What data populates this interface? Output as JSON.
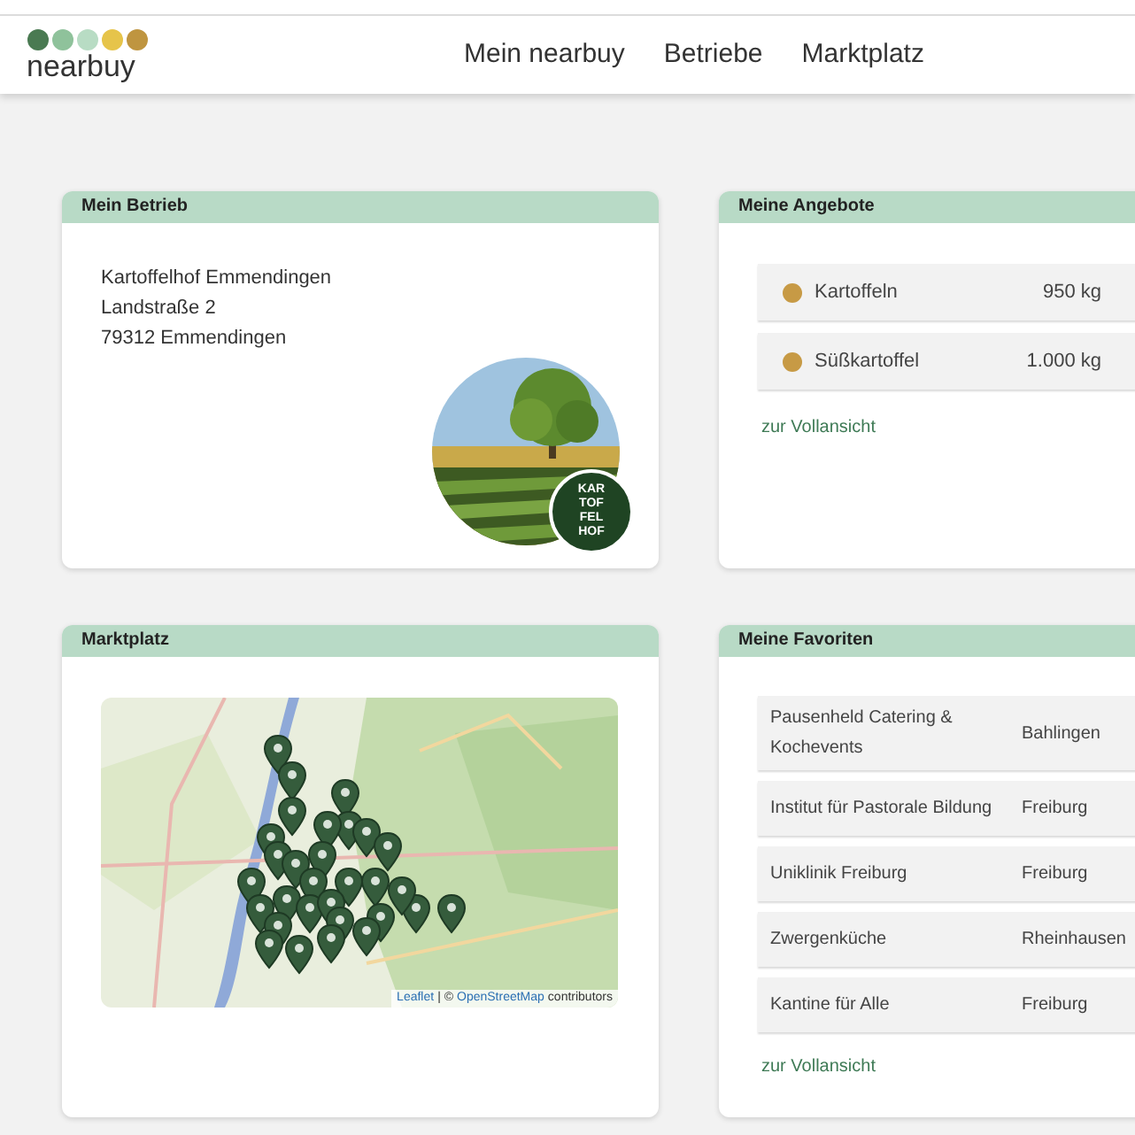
{
  "header": {
    "logo": {
      "text": "nearbuy"
    },
    "nav": [
      {
        "label": "Mein nearbuy"
      },
      {
        "label": "Betriebe"
      },
      {
        "label": "Marktplatz"
      }
    ]
  },
  "my_business": {
    "title": "Mein Betrieb",
    "address": [
      "Kartoffelhof Emmendingen",
      "Landstraße 2",
      "79312 Emmendingen"
    ],
    "logo_lines": [
      "KAR",
      "TOF",
      "FEL",
      "HOF"
    ]
  },
  "my_offers": {
    "title": "Meine Angebote",
    "items": [
      {
        "name": "Kartoffeln",
        "quantity": "950 kg",
        "color": "#c79a45"
      },
      {
        "name": "Süßkartoffel",
        "quantity": "1.000 kg",
        "color": "#c79a45"
      }
    ],
    "link": "zur Vollansicht"
  },
  "marketplace": {
    "title": "Marktplatz",
    "map": {
      "kind": "picture",
      "attribution_link": "Leaflet",
      "attribution_sep": "| ©",
      "attribution_source": "OpenStreetMap",
      "attribution_rest": "contributors"
    }
  },
  "favorites": {
    "title": "Meine Favoriten",
    "items": [
      {
        "name": "Pausenheld Catering & Kochevents",
        "city": "Bahlingen"
      },
      {
        "name": "Institut für Pastorale Bildung",
        "city": "Freiburg"
      },
      {
        "name": "Uniklinik Freiburg",
        "city": "Freiburg"
      },
      {
        "name": "Zwergenküche",
        "city": "Rheinhausen"
      },
      {
        "name": "Kantine für Alle",
        "city": "Freiburg"
      }
    ],
    "link": "zur Vollansicht"
  }
}
